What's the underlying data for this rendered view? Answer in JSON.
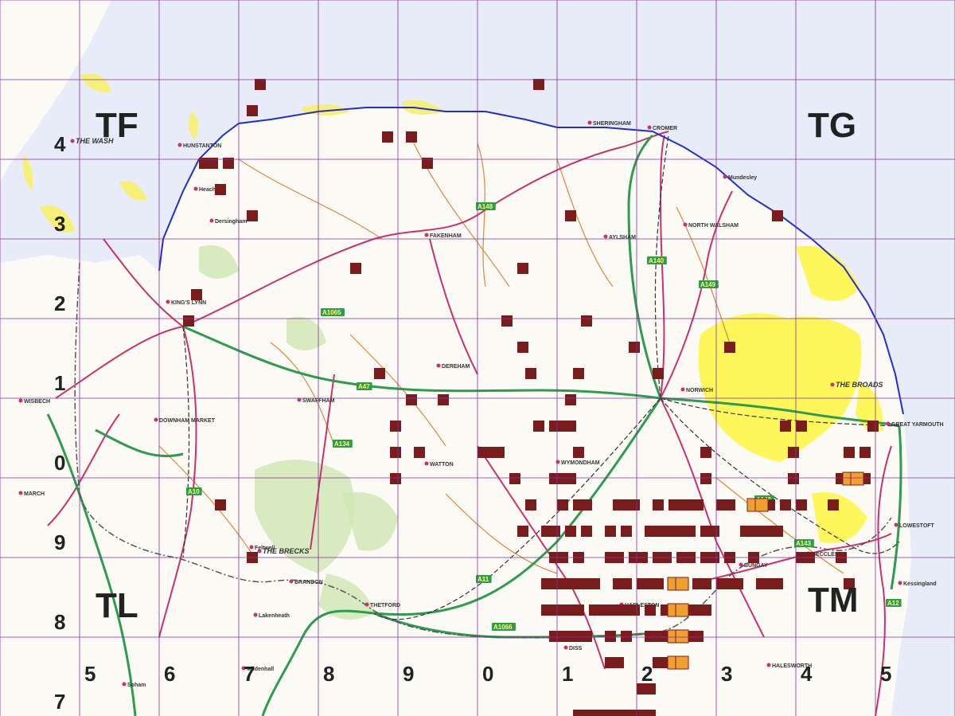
{
  "map": {
    "colors": {
      "sea": "#e8ecf8",
      "land": "#fbfaf4",
      "grid": "#8a2fa0",
      "recordSquare": "#7a1c1c",
      "highlightSquare": "#f0a030",
      "coast": "#2030c8",
      "sand": "#f6ef7a",
      "broads": "#fff52a",
      "woodland": "#cfe6b3",
      "roadPrimary": "#2e9b4e",
      "roadA": "#c8326e",
      "roadB": "#d98a3a",
      "railway": "#333333",
      "county": "#555555"
    },
    "grid_regions": [
      {
        "id": "tf",
        "label": "TF"
      },
      {
        "id": "tg",
        "label": "TG"
      },
      {
        "id": "tl",
        "label": "TL"
      },
      {
        "id": "tm",
        "label": "TM"
      }
    ],
    "easting_labels": [
      "5",
      "6",
      "7",
      "8",
      "9",
      "0",
      "1",
      "2",
      "3",
      "4",
      "5"
    ],
    "northing_labels": [
      "4",
      "3",
      "2",
      "1",
      "0",
      "9",
      "8",
      "7"
    ],
    "place_names": [
      {
        "id": "hunstanton",
        "text": "HUNSTANTON"
      },
      {
        "id": "kings-lynn",
        "text": "KING'S LYNN"
      },
      {
        "id": "fakenham",
        "text": "FAKENHAM"
      },
      {
        "id": "sheringham",
        "text": "SHERINGHAM"
      },
      {
        "id": "cromer",
        "text": "CROMER"
      },
      {
        "id": "north-walsham",
        "text": "NORTH WALSHAM"
      },
      {
        "id": "dereham",
        "text": "DEREHAM"
      },
      {
        "id": "swaffham",
        "text": "SWAFFHAM"
      },
      {
        "id": "downham-market",
        "text": "DOWNHAM MARKET"
      },
      {
        "id": "wisbech",
        "text": "WISBECH"
      },
      {
        "id": "march",
        "text": "MARCH"
      },
      {
        "id": "thetford",
        "text": "THETFORD"
      },
      {
        "id": "brandon",
        "text": "BRANDON"
      },
      {
        "id": "watton",
        "text": "WATTON"
      },
      {
        "id": "wymondham",
        "text": "WYMONDHAM"
      },
      {
        "id": "norwich",
        "text": "NORWICH"
      },
      {
        "id": "great-yarmouth",
        "text": "GREAT YARMOUTH"
      },
      {
        "id": "lowestoft",
        "text": "LOWESTOFT"
      },
      {
        "id": "beccles",
        "text": "BECCLES"
      },
      {
        "id": "bungay",
        "text": "BUNGAY"
      },
      {
        "id": "harleston",
        "text": "HARLESTON"
      },
      {
        "id": "halesworth",
        "text": "HALESWORTH"
      },
      {
        "id": "diss",
        "text": "DISS"
      },
      {
        "id": "the-brecks",
        "text": "THE BRECKS"
      },
      {
        "id": "the-broads",
        "text": "THE BROADS"
      },
      {
        "id": "the-wash",
        "text": "THE WASH"
      },
      {
        "id": "kessingland",
        "text": "Kessingland"
      },
      {
        "id": "mundesley",
        "text": "Mundesley"
      },
      {
        "id": "aylsham",
        "text": "AYLSHAM"
      },
      {
        "id": "lakenheath",
        "text": "Lakenheath"
      },
      {
        "id": "mildenhall",
        "text": "Mildenhall"
      },
      {
        "id": "soham",
        "text": "Soham"
      },
      {
        "id": "feltwell",
        "text": "Feltwell"
      },
      {
        "id": "dersingham",
        "text": "Dersingham"
      },
      {
        "id": "heacham",
        "text": "Heacham"
      }
    ],
    "recorded_squares": [
      "32,3",
      "67,3",
      "31,4",
      "53,6",
      "48,5",
      "51,5",
      "25,6",
      "26,6",
      "28,6",
      "27,7",
      "31,8",
      "71,8",
      "97,8",
      "44,10",
      "65,10",
      "23,12",
      "24,11",
      "73,12",
      "63,12",
      "79,13",
      "65,13",
      "66,14",
      "72,14",
      "82,14",
      "91,13",
      "47,14",
      "51,15",
      "55,15",
      "70,16",
      "71,15",
      "98,16",
      "49,16",
      "60,17",
      "62,17",
      "67,16",
      "69,16",
      "71,16",
      "88,17",
      "99,17",
      "100,16",
      "108,17",
      "109,16",
      "49,17",
      "61,17",
      "72,17",
      "99,18",
      "108,18",
      "49,18",
      "52,17",
      "64,18",
      "69,18",
      "70,18",
      "71,18",
      "88,18",
      "96,19",
      "98,19",
      "100,19",
      "104,19",
      "105,18",
      "106,17",
      "27,19",
      "66,19",
      "70,19",
      "72,19",
      "73,19",
      "77,19",
      "78,19",
      "79,19",
      "82,19",
      "84,19",
      "85,19",
      "86,19",
      "87,19",
      "90,19",
      "91,19",
      "31,21",
      "65,20",
      "68,20",
      "69,20",
      "71,20",
      "73,20",
      "76,20",
      "78,20",
      "81,20",
      "82,20",
      "83,20",
      "84,20",
      "85,20",
      "86,20",
      "88,20",
      "89,20",
      "93,20",
      "94,20",
      "95,20",
      "96,20",
      "97,20",
      "69,21",
      "70,21",
      "72,21",
      "76,21",
      "77,21",
      "79,21",
      "80,21",
      "82,21",
      "83,21",
      "85,21",
      "86,21",
      "88,21",
      "89,21",
      "91,21",
      "94,21",
      "100,21",
      "101,21",
      "105,21",
      "68,22",
      "69,22",
      "70,22",
      "71,22",
      "72,22",
      "73,22",
      "74,22",
      "77,22",
      "78,22",
      "80,22",
      "81,22",
      "82,22",
      "87,22",
      "88,22",
      "90,22",
      "91,22",
      "92,22",
      "95,22",
      "96,22",
      "97,22",
      "106,22",
      "68,23",
      "69,23",
      "70,23",
      "71,23",
      "72,23",
      "74,23",
      "75,23",
      "76,23",
      "77,23",
      "78,23",
      "79,23",
      "81,23",
      "83,23",
      "86,23",
      "87,23",
      "88,23",
      "69,24",
      "70,24",
      "71,24",
      "72,24",
      "73,24",
      "76,24",
      "78,24",
      "81,24",
      "82,24",
      "83,24",
      "86,24",
      "87,24",
      "76,25",
      "77,25",
      "82,25",
      "83,25",
      "80,26",
      "81,26",
      "72,27",
      "73,27",
      "74,27",
      "75,27",
      "76,27",
      "77,27",
      "78,27",
      "79,27",
      "80,27",
      "81,27"
    ],
    "highlight_squares": [
      "94,19",
      "95,19",
      "106,18",
      "107,18",
      "84,22",
      "84,23",
      "84,24",
      "84,25",
      "85,22",
      "85,23",
      "85,24",
      "85,25"
    ],
    "roads": [
      {
        "id": "a47-label",
        "text": "A47"
      },
      {
        "id": "a11-label",
        "text": "A11"
      },
      {
        "id": "a140-label",
        "text": "A140"
      },
      {
        "id": "a148-label",
        "text": "A148"
      },
      {
        "id": "a149-label",
        "text": "A149"
      },
      {
        "id": "a134-label",
        "text": "A134"
      },
      {
        "id": "a143-label",
        "text": "A143"
      },
      {
        "id": "a12-label",
        "text": "A12"
      },
      {
        "id": "a10-label",
        "text": "A10"
      },
      {
        "id": "a1065-label",
        "text": "A1065"
      },
      {
        "id": "a1066-label",
        "text": "A1066"
      },
      {
        "id": "a146-label",
        "text": "A146"
      }
    ]
  }
}
